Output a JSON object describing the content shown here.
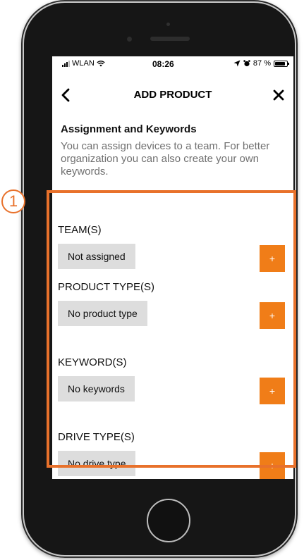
{
  "status_bar": {
    "carrier": "WLAN",
    "time": "08:26",
    "battery": "87 %",
    "battery_level": 0.87
  },
  "nav": {
    "title": "ADD PRODUCT",
    "back_icon": "chevron-left-icon",
    "close_icon": "close-icon"
  },
  "section": {
    "title": "Assignment and Keywords",
    "description": "You can assign devices to a team. For better organization you can also create your own keywords."
  },
  "marker": {
    "label": "1"
  },
  "groups": [
    {
      "label": "TEAM(S)",
      "value": "Not assigned",
      "add_label": "+"
    },
    {
      "label": "PRODUCT TYPE(S)",
      "value": "No product type",
      "add_label": "+"
    },
    {
      "label": "KEYWORD(S)",
      "value": "No keywords",
      "add_label": "+"
    },
    {
      "label": "DRIVE TYPE(S)",
      "value": "No drive type",
      "add_label": "+"
    }
  ],
  "colors": {
    "accent": "#f07d18",
    "highlight_border": "#e8712b",
    "chip_bg": "#dddddd",
    "description_text": "#707070"
  }
}
